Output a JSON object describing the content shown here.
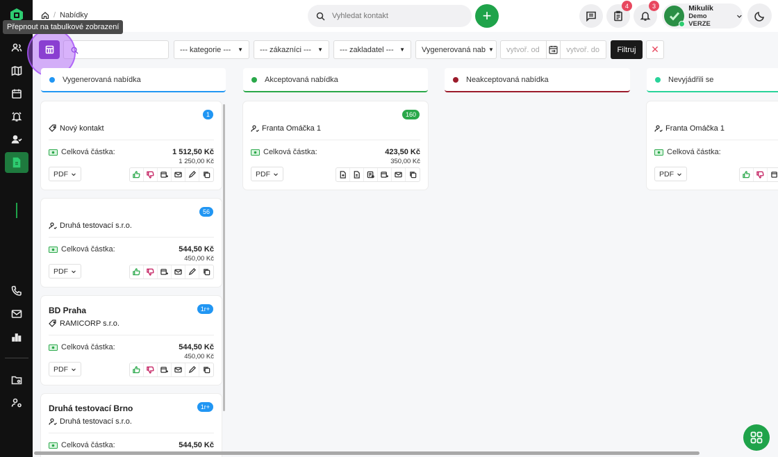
{
  "header": {
    "breadcrumb": "Nabídky",
    "search_placeholder": "Vyhledat kontakt",
    "add_label": "+",
    "tasks_badge": "4",
    "notifications_badge": "3",
    "user_name": "Mikulík",
    "user_role": "Demo VERZE"
  },
  "tooltip": "Přepnout na tabulkové zobrazení",
  "filters": {
    "search_placeholder": "",
    "kategorie": "--- kategorie ---",
    "zakaznici": "--- zákazníci ---",
    "zakladatel": "--- zakladatel ---",
    "stav": "Vygenerovaná nab",
    "date_from": "vytvoř. od",
    "date_to": "vytvoř. do",
    "filter_label": "Filtruj",
    "clear_label": "✕"
  },
  "columns": [
    {
      "label": "Vygenerovaná nabídka",
      "color": "#2196f3"
    },
    {
      "label": "Akceptovaná nabídka",
      "color": "#2aa84a"
    },
    {
      "label": "Neakceptovaná nabídka",
      "color": "#9b1b2b"
    },
    {
      "label": "Nevyjádřili se",
      "color": "#29d39a"
    }
  ],
  "amount_label": "Celková částka:",
  "pdf_label": "PDF",
  "cards": [
    {
      "num": "1",
      "title": "",
      "contact": "Nový kontakt",
      "amount": "1 512,50 Kč",
      "sub": "1 250,00 Kč"
    },
    {
      "num": "56",
      "title": "",
      "contact": "Druhá testovací s.r.o.",
      "amount": "544,50 Kč",
      "sub": "450,00 Kč"
    },
    {
      "num": "1r+",
      "title": "BD Praha",
      "contact": "RAMICORP s.r.o.",
      "amount": "544,50 Kč",
      "sub": "450,00 Kč"
    },
    {
      "num": "1r+",
      "title": "Druhá testovací Brno",
      "contact": "Druhá testovací s.r.o.",
      "amount": "544,50 Kč",
      "sub": ""
    },
    {
      "num": "160",
      "title": "",
      "contact": "Franta Omáčka 1",
      "amount": "423,50 Kč",
      "sub": "350,00 Kč"
    },
    {
      "num": "",
      "title": "",
      "contact": "Franta Omáčka 1",
      "amount": "",
      "sub": ""
    }
  ],
  "colors": {
    "accent_green": "#1fa34a",
    "badge_red": "#e8485f",
    "highlight_purple": "#a855f7"
  }
}
